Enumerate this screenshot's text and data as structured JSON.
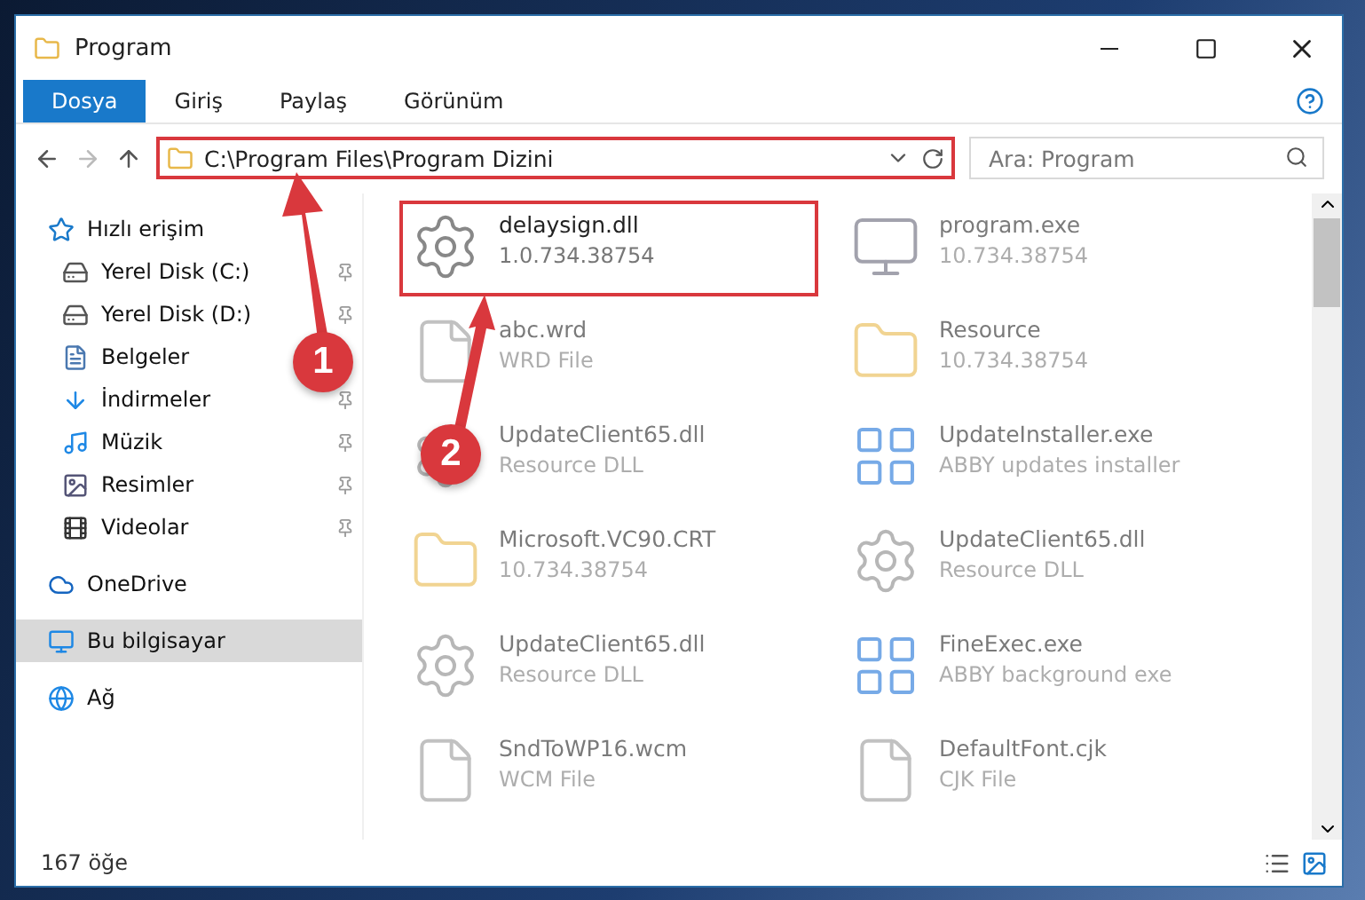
{
  "window": {
    "title": "Program"
  },
  "ribbon_tabs": [
    {
      "label": "Dosya",
      "selected": true
    },
    {
      "label": "Giriş",
      "selected": false
    },
    {
      "label": "Paylaş",
      "selected": false
    },
    {
      "label": "Görünüm",
      "selected": false
    }
  ],
  "address": {
    "path": "C:\\Program Files\\Program Dizini",
    "highlighted": true
  },
  "search": {
    "placeholder": "Ara: Program"
  },
  "sidebar": {
    "items": [
      {
        "label": "Hızlı erişim",
        "kind": "star",
        "selected": false,
        "children": [
          {
            "label": "Yerel Disk (C:)",
            "kind": "drive",
            "pinned": true,
            "selected": false
          },
          {
            "label": "Yerel Disk (D:)",
            "kind": "drive",
            "pinned": true,
            "selected": false
          },
          {
            "label": "Belgeler",
            "kind": "docs",
            "pinned": false,
            "selected": false
          },
          {
            "label": "İndirmeler",
            "kind": "download",
            "pinned": true,
            "selected": false
          },
          {
            "label": "Müzik",
            "kind": "music",
            "pinned": true,
            "selected": false
          },
          {
            "label": "Resimler",
            "kind": "pictures",
            "pinned": true,
            "selected": false
          },
          {
            "label": "Videolar",
            "kind": "video",
            "pinned": true,
            "selected": false
          }
        ]
      },
      {
        "label": "OneDrive",
        "kind": "cloud",
        "selected": false
      },
      {
        "label": "Bu bilgisayar",
        "kind": "pc",
        "selected": true
      },
      {
        "label": "Ağ",
        "kind": "network",
        "selected": false
      }
    ]
  },
  "files": [
    {
      "name": "delaysign.dll",
      "detail": "1.0.734.38754",
      "kind": "dll",
      "blurred": false,
      "highlighted": true
    },
    {
      "name": "program.exe",
      "detail": "10.734.38754",
      "kind": "app",
      "blurred": true,
      "highlighted": false
    },
    {
      "name": "abc.wrd",
      "detail": "WRD File",
      "kind": "file",
      "blurred": true,
      "highlighted": false
    },
    {
      "name": "Resource",
      "detail": "10.734.38754",
      "kind": "folder",
      "blurred": true,
      "highlighted": false
    },
    {
      "name": "UpdateClient65.dll",
      "detail": "Resource DLL",
      "kind": "dll",
      "blurred": true,
      "highlighted": false
    },
    {
      "name": "UpdateInstaller.exe",
      "detail": "ABBY updates installer",
      "kind": "exe",
      "blurred": true,
      "highlighted": false
    },
    {
      "name": "Microsoft.VC90.CRT",
      "detail": "10.734.38754",
      "kind": "folder",
      "blurred": true,
      "highlighted": false
    },
    {
      "name": "UpdateClient65.dll",
      "detail": "Resource DLL",
      "kind": "dll",
      "blurred": true,
      "highlighted": false
    },
    {
      "name": "UpdateClient65.dll",
      "detail": "Resource DLL",
      "kind": "dll",
      "blurred": true,
      "highlighted": false
    },
    {
      "name": "FineExec.exe",
      "detail": "ABBY background exe",
      "kind": "exe",
      "blurred": true,
      "highlighted": false
    },
    {
      "name": "SndToWP16.wcm",
      "detail": "WCM File",
      "kind": "file",
      "blurred": true,
      "highlighted": false
    },
    {
      "name": "DefaultFont.cjk",
      "detail": "CJK File",
      "kind": "file",
      "blurred": true,
      "highlighted": false
    }
  ],
  "status_bar": {
    "count": "167 öğe"
  },
  "annotations": [
    {
      "label": "1"
    },
    {
      "label": "2"
    }
  ]
}
